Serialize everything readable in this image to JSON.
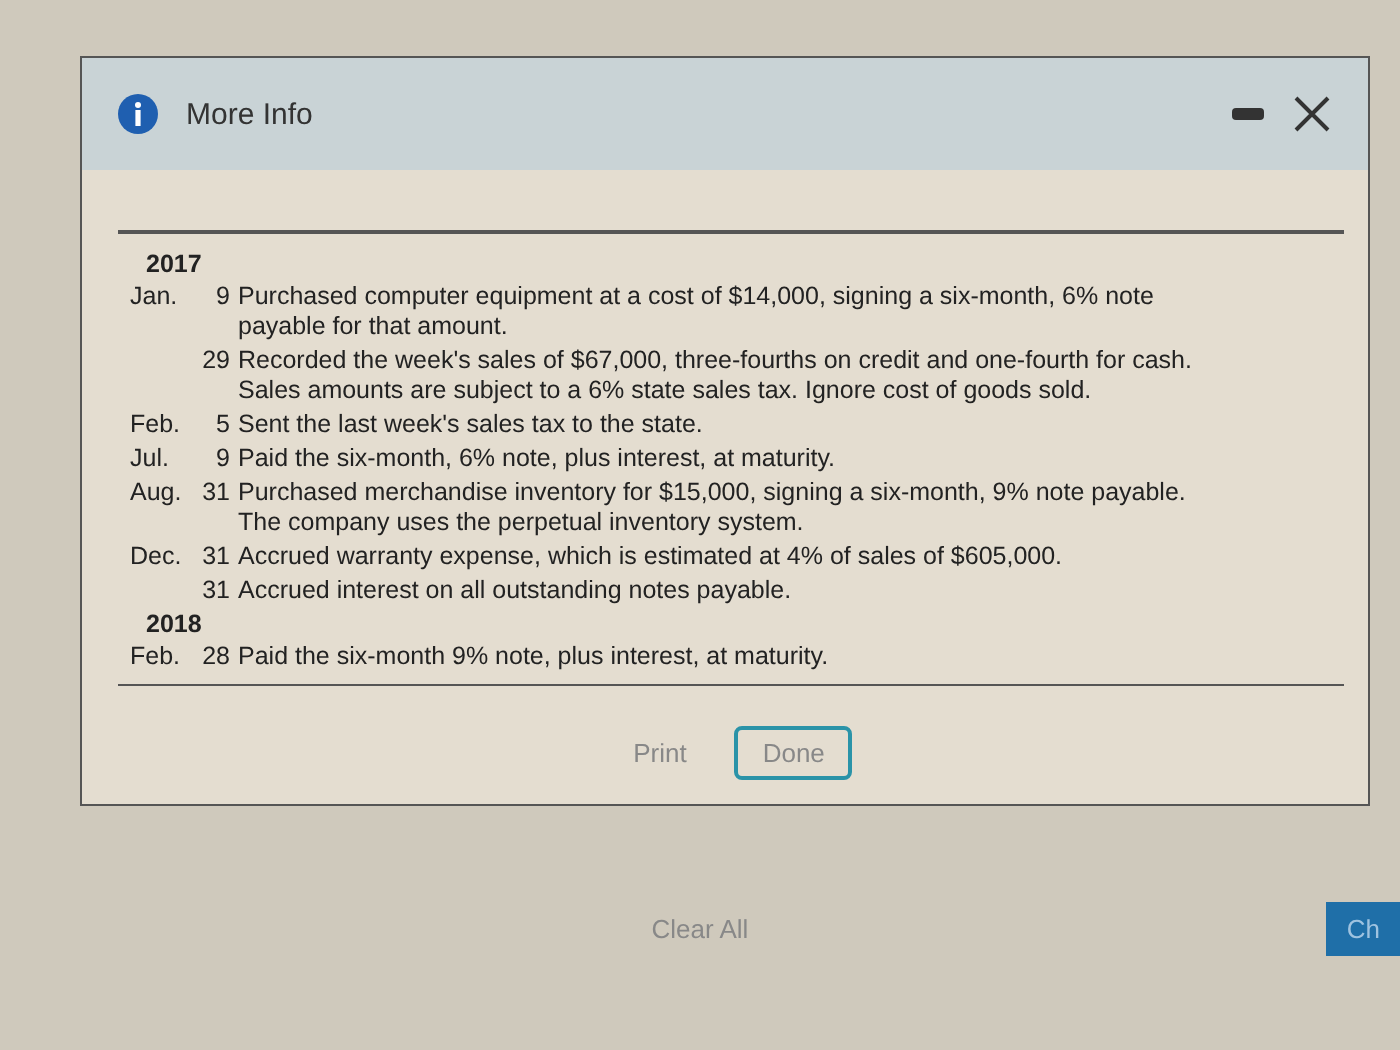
{
  "dialog": {
    "title": "More Info",
    "entries": [
      {
        "kind": "year",
        "text": "2017"
      },
      {
        "kind": "entry",
        "month": "Jan.",
        "day": "9",
        "text": "Purchased computer equipment at a cost of $14,000, signing a six-month, 6% note payable for that amount."
      },
      {
        "kind": "entry",
        "day": "29",
        "text": "Recorded the week's sales of $67,000, three-fourths on credit and one-fourth for cash. Sales amounts are subject to a 6% state sales tax. Ignore cost of goods sold."
      },
      {
        "kind": "entry",
        "month": "Feb.",
        "day": "5",
        "text": "Sent the last week's sales tax to the state."
      },
      {
        "kind": "entry",
        "month": "Jul.",
        "day": "9",
        "text": "Paid the six-month, 6% note, plus interest, at maturity."
      },
      {
        "kind": "entry",
        "month": "Aug.",
        "day": "31",
        "text": "Purchased merchandise inventory for $15,000, signing a six-month, 9% note payable. The company uses the perpetual inventory system."
      },
      {
        "kind": "entry",
        "month": "Dec.",
        "day": "31",
        "text": "Accrued warranty expense, which is estimated at 4% of sales of $605,000."
      },
      {
        "kind": "entry",
        "day": "31",
        "text": "Accrued interest on all outstanding notes payable."
      },
      {
        "kind": "year",
        "text": "2018"
      },
      {
        "kind": "entry",
        "month": "Feb.",
        "day": "28",
        "text": "Paid the six-month 9% note, plus interest, at maturity."
      }
    ],
    "buttons": [
      {
        "label": "Print",
        "kind": "plain"
      },
      {
        "label": "Done",
        "kind": "outlined"
      }
    ]
  },
  "page": {
    "clear_button": "Clear All",
    "check_button": "Ch"
  }
}
